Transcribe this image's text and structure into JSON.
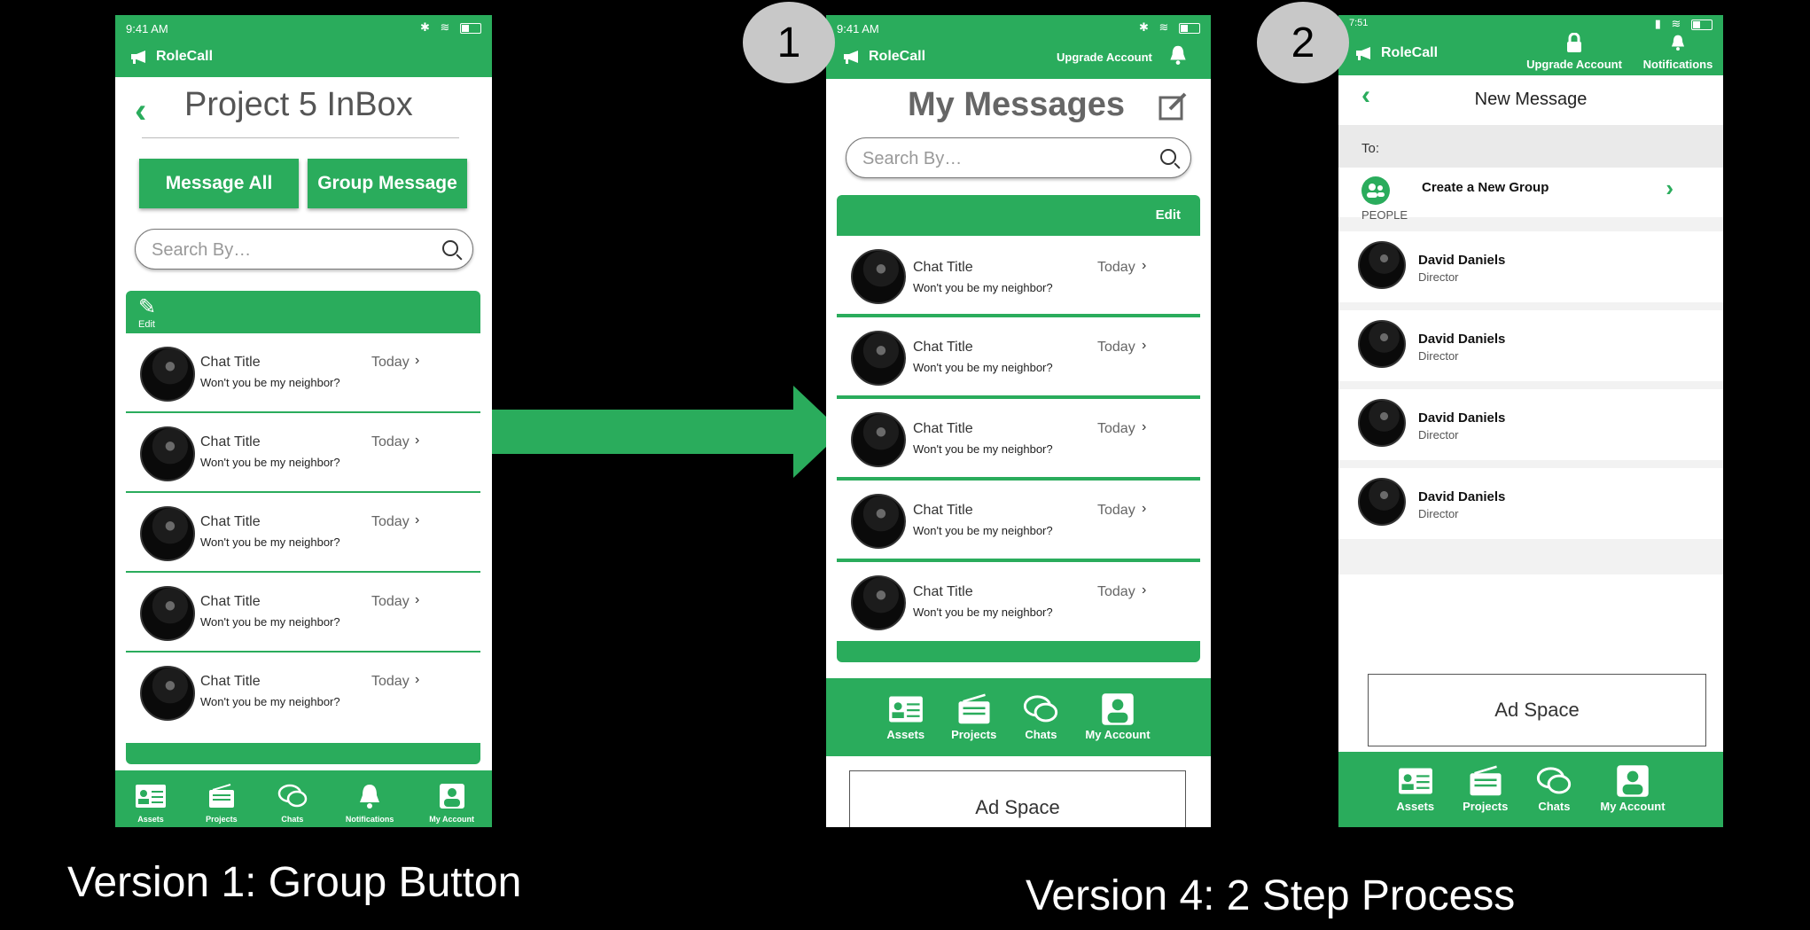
{
  "brand": "RoleCall",
  "colors": {
    "accent": "#2aac5c",
    "background": "#000000"
  },
  "rows": [
    {
      "title": "Chat Title",
      "preview": "Won't you be my neighbor?",
      "date": "Today"
    },
    {
      "title": "Chat Title",
      "preview": "Won't you be my neighbor?",
      "date": "Today"
    },
    {
      "title": "Chat Title",
      "preview": "Won't you be my neighbor?",
      "date": "Today"
    },
    {
      "title": "Chat Title",
      "preview": "Won't you be my neighbor?",
      "date": "Today"
    },
    {
      "title": "Chat Title",
      "preview": "Won't you be my neighbor?",
      "date": "Today"
    }
  ],
  "v1": {
    "time": "9:41 AM",
    "title": "Project 5 InBox",
    "message_all": "Message All",
    "group_message": "Group Message",
    "search_placeholder": "Search By…",
    "edit": "Edit",
    "tabs": [
      "Assets",
      "Projects",
      "Chats",
      "Notifications",
      "My Account"
    ]
  },
  "v4a": {
    "badge": "1",
    "time": "9:41 AM",
    "upgrade": "Upgrade Account",
    "title": "My Messages",
    "search_placeholder": "Search By…",
    "edit": "Edit",
    "tabs": [
      "Assets",
      "Projects",
      "Chats",
      "My Account"
    ],
    "ad": "Ad Space"
  },
  "v4b": {
    "badge": "2",
    "time": "7:51",
    "upgrade": "Upgrade Account",
    "notifications": "Notifications",
    "title": "New Message",
    "to": "To:",
    "create_group": "Create a New Group",
    "people_header": "PEOPLE",
    "people": [
      {
        "name": "David Daniels",
        "role": "Director"
      },
      {
        "name": "David Daniels",
        "role": "Director"
      },
      {
        "name": "David Daniels",
        "role": "Director"
      },
      {
        "name": "David Daniels",
        "role": "Director"
      }
    ],
    "ad": "Ad Space",
    "tabs": [
      "Assets",
      "Projects",
      "Chats",
      "My Account"
    ]
  },
  "captions": {
    "v1": "Version 1: Group Button",
    "v4": "Version 4: 2 Step Process"
  },
  "icons": [
    "megaphone-icon",
    "back-chevron-icon",
    "pencil-icon",
    "compose-icon",
    "search-icon",
    "bell-icon",
    "lock-icon",
    "group-icon",
    "arrow-right-icon",
    "assets-icon",
    "projects-icon",
    "chats-icon",
    "account-icon"
  ]
}
